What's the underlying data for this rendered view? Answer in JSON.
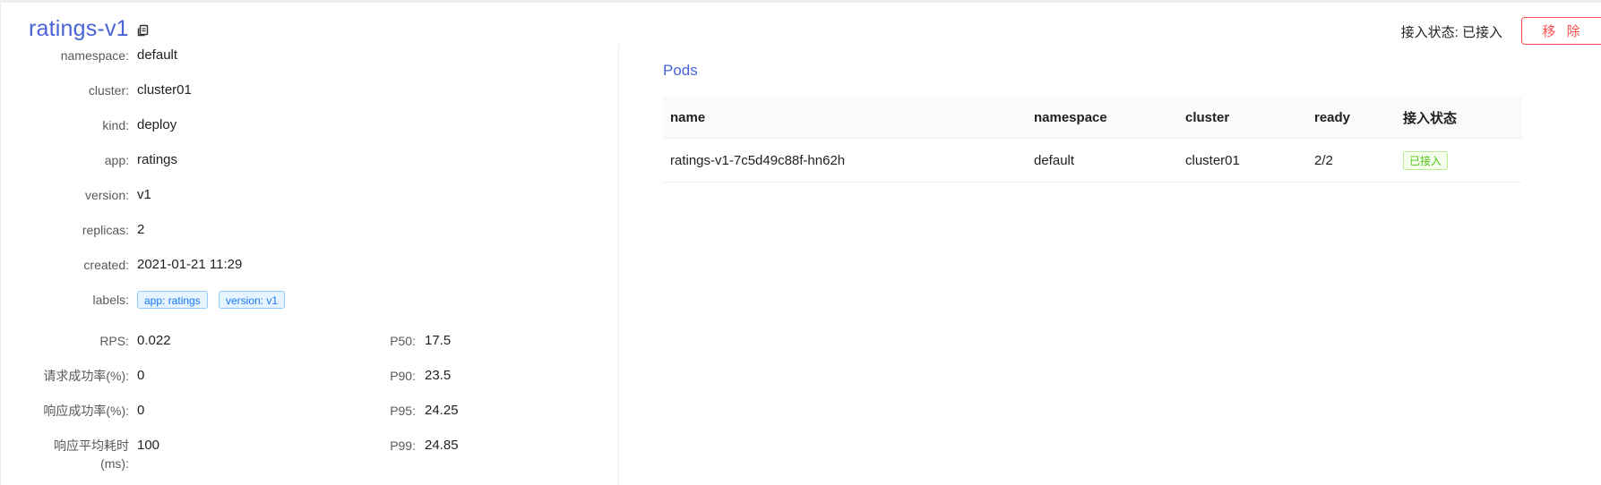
{
  "header": {
    "title": "ratings-v1",
    "access_status_label": "接入状态:",
    "access_status_value": "已接入",
    "remove_label": "移 除"
  },
  "details": {
    "namespace": {
      "label": "namespace:",
      "value": "default"
    },
    "cluster": {
      "label": "cluster:",
      "value": "cluster01"
    },
    "kind": {
      "label": "kind:",
      "value": "deploy"
    },
    "app": {
      "label": "app:",
      "value": "ratings"
    },
    "version": {
      "label": "version:",
      "value": "v1"
    },
    "replicas": {
      "label": "replicas:",
      "value": "2"
    },
    "created": {
      "label": "created:",
      "value": "2021-01-21 11:29"
    },
    "labels": {
      "label": "labels:",
      "tags": [
        "app: ratings",
        "version: v1"
      ]
    }
  },
  "metrics": {
    "rps": {
      "label": "RPS:",
      "value": "0.022"
    },
    "success_rate": {
      "label": "请求成功率(%):",
      "value": "0"
    },
    "response_success_rate": {
      "label": "响应成功率(%):",
      "value": "0"
    },
    "avg_latency": {
      "label_line1": "响应平均耗时",
      "label_line2": "(ms):",
      "value": "100"
    },
    "p50": {
      "label": "P50:",
      "value": "17.5"
    },
    "p90": {
      "label": "P90:",
      "value": "23.5"
    },
    "p95": {
      "label": "P95:",
      "value": "24.25"
    },
    "p99": {
      "label": "P99:",
      "value": "24.85"
    }
  },
  "pods": {
    "title": "Pods",
    "columns": [
      "name",
      "namespace",
      "cluster",
      "ready",
      "接入状态"
    ],
    "rows": [
      {
        "name": "ratings-v1-7c5d49c88f-hn62h",
        "namespace": "default",
        "cluster": "cluster01",
        "ready": "2/2",
        "status": "已接入"
      }
    ]
  },
  "icons": {
    "copy": "copy-icon"
  },
  "colors": {
    "title": "#4a63d6",
    "danger": "#ff4d4f",
    "tag_blue": "#1677ff",
    "tag_green": "#52c41a"
  }
}
